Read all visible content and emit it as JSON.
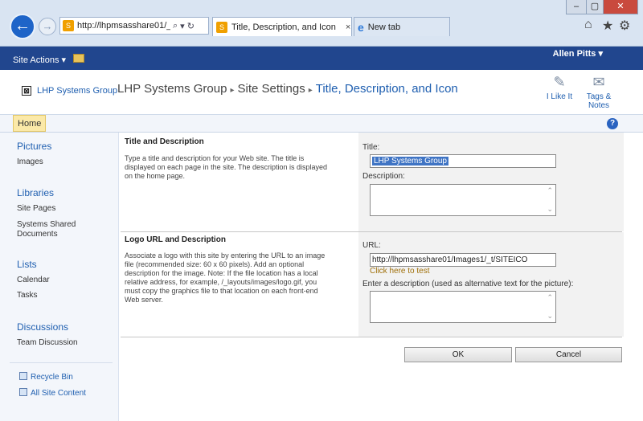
{
  "browser": {
    "address": "http://lhpmsasshare01/_",
    "address_icons": [
      "search-icon",
      "dropdown-icon",
      "refresh-icon"
    ],
    "tabs": [
      {
        "label": "Title, Description, and Icon",
        "active": true
      },
      {
        "label": "New tab",
        "active": false
      }
    ],
    "tab_close": "×",
    "window_buttons": [
      "–",
      "▢",
      "✕"
    ],
    "toolbar_icons": [
      "home-icon",
      "favorites-icon",
      "settings-icon"
    ]
  },
  "ribbon": {
    "site_actions": "Site Actions ▾",
    "user": "Allen Pitts ▾"
  },
  "header": {
    "site_logo": "⊠",
    "site_name": "LHP Systems Group",
    "breadcrumb": [
      "LHP Systems Group",
      "Site Settings",
      "Title, Description, and Icon"
    ],
    "breadcrumb_sep": "▸",
    "social": [
      {
        "label": "I Like It",
        "icon": "like-icon"
      },
      {
        "label": "Tags &",
        "label2": "Notes",
        "icon": "tags-icon"
      }
    ]
  },
  "home_bar": {
    "home": "Home",
    "help": "?"
  },
  "left_nav": {
    "groups": [
      {
        "heading": "Pictures",
        "items": [
          "Images"
        ]
      },
      {
        "heading": "Libraries",
        "items": [
          "Site Pages",
          "Systems Shared Documents"
        ]
      },
      {
        "heading": "Lists",
        "items": [
          "Calendar",
          "Tasks"
        ]
      },
      {
        "heading": "Discussions",
        "items": [
          "Team Discussion"
        ]
      }
    ],
    "recycle_bin": "Recycle Bin",
    "all_site_content": "All Site Content"
  },
  "sections": {
    "title_desc": {
      "title": "Title and Description",
      "description": "Type a title and description for your Web site. The title is displayed on each page in the site. The description is displayed on the home page.",
      "title_label": "Title:",
      "title_value": "LHP Systems Group",
      "description_label": "Description:",
      "description_value": ""
    },
    "logo": {
      "title": "Logo URL and Description",
      "description": "Associate a logo with this site by entering the URL to an image file (recommended size: 60 x 60 pixels). Add an optional description for the image. Note: If the file location has a local relative address, for example, /_layouts/images/logo.gif, you must copy the graphics file to that location on each front-end Web server.",
      "url_label": "URL:",
      "url_value": "http://lhpmsasshare01/Images1/_t/SITEICO",
      "test_link": "Click here to test",
      "alt_label": "Enter a description (used as alternative text for the picture):",
      "alt_value": ""
    }
  },
  "buttons": {
    "ok": "OK",
    "cancel": "Cancel"
  },
  "colors": {
    "ribbon": "#21468e",
    "link": "#1f5fb0",
    "home_tab": "#fbe9a8"
  }
}
